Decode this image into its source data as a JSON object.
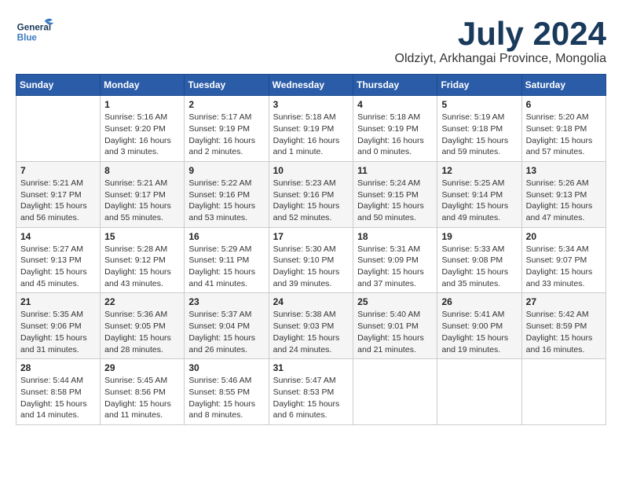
{
  "header": {
    "logo_general": "General",
    "logo_blue": "Blue",
    "month": "July 2024",
    "location": "Oldziyt, Arkhangai Province, Mongolia"
  },
  "weekdays": [
    "Sunday",
    "Monday",
    "Tuesday",
    "Wednesday",
    "Thursday",
    "Friday",
    "Saturday"
  ],
  "weeks": [
    [
      {
        "day": "",
        "info": ""
      },
      {
        "day": "1",
        "info": "Sunrise: 5:16 AM\nSunset: 9:20 PM\nDaylight: 16 hours\nand 3 minutes."
      },
      {
        "day": "2",
        "info": "Sunrise: 5:17 AM\nSunset: 9:19 PM\nDaylight: 16 hours\nand 2 minutes."
      },
      {
        "day": "3",
        "info": "Sunrise: 5:18 AM\nSunset: 9:19 PM\nDaylight: 16 hours\nand 1 minute."
      },
      {
        "day": "4",
        "info": "Sunrise: 5:18 AM\nSunset: 9:19 PM\nDaylight: 16 hours\nand 0 minutes."
      },
      {
        "day": "5",
        "info": "Sunrise: 5:19 AM\nSunset: 9:18 PM\nDaylight: 15 hours\nand 59 minutes."
      },
      {
        "day": "6",
        "info": "Sunrise: 5:20 AM\nSunset: 9:18 PM\nDaylight: 15 hours\nand 57 minutes."
      }
    ],
    [
      {
        "day": "7",
        "info": "Sunrise: 5:21 AM\nSunset: 9:17 PM\nDaylight: 15 hours\nand 56 minutes."
      },
      {
        "day": "8",
        "info": "Sunrise: 5:21 AM\nSunset: 9:17 PM\nDaylight: 15 hours\nand 55 minutes."
      },
      {
        "day": "9",
        "info": "Sunrise: 5:22 AM\nSunset: 9:16 PM\nDaylight: 15 hours\nand 53 minutes."
      },
      {
        "day": "10",
        "info": "Sunrise: 5:23 AM\nSunset: 9:16 PM\nDaylight: 15 hours\nand 52 minutes."
      },
      {
        "day": "11",
        "info": "Sunrise: 5:24 AM\nSunset: 9:15 PM\nDaylight: 15 hours\nand 50 minutes."
      },
      {
        "day": "12",
        "info": "Sunrise: 5:25 AM\nSunset: 9:14 PM\nDaylight: 15 hours\nand 49 minutes."
      },
      {
        "day": "13",
        "info": "Sunrise: 5:26 AM\nSunset: 9:13 PM\nDaylight: 15 hours\nand 47 minutes."
      }
    ],
    [
      {
        "day": "14",
        "info": "Sunrise: 5:27 AM\nSunset: 9:13 PM\nDaylight: 15 hours\nand 45 minutes."
      },
      {
        "day": "15",
        "info": "Sunrise: 5:28 AM\nSunset: 9:12 PM\nDaylight: 15 hours\nand 43 minutes."
      },
      {
        "day": "16",
        "info": "Sunrise: 5:29 AM\nSunset: 9:11 PM\nDaylight: 15 hours\nand 41 minutes."
      },
      {
        "day": "17",
        "info": "Sunrise: 5:30 AM\nSunset: 9:10 PM\nDaylight: 15 hours\nand 39 minutes."
      },
      {
        "day": "18",
        "info": "Sunrise: 5:31 AM\nSunset: 9:09 PM\nDaylight: 15 hours\nand 37 minutes."
      },
      {
        "day": "19",
        "info": "Sunrise: 5:33 AM\nSunset: 9:08 PM\nDaylight: 15 hours\nand 35 minutes."
      },
      {
        "day": "20",
        "info": "Sunrise: 5:34 AM\nSunset: 9:07 PM\nDaylight: 15 hours\nand 33 minutes."
      }
    ],
    [
      {
        "day": "21",
        "info": "Sunrise: 5:35 AM\nSunset: 9:06 PM\nDaylight: 15 hours\nand 31 minutes."
      },
      {
        "day": "22",
        "info": "Sunrise: 5:36 AM\nSunset: 9:05 PM\nDaylight: 15 hours\nand 28 minutes."
      },
      {
        "day": "23",
        "info": "Sunrise: 5:37 AM\nSunset: 9:04 PM\nDaylight: 15 hours\nand 26 minutes."
      },
      {
        "day": "24",
        "info": "Sunrise: 5:38 AM\nSunset: 9:03 PM\nDaylight: 15 hours\nand 24 minutes."
      },
      {
        "day": "25",
        "info": "Sunrise: 5:40 AM\nSunset: 9:01 PM\nDaylight: 15 hours\nand 21 minutes."
      },
      {
        "day": "26",
        "info": "Sunrise: 5:41 AM\nSunset: 9:00 PM\nDaylight: 15 hours\nand 19 minutes."
      },
      {
        "day": "27",
        "info": "Sunrise: 5:42 AM\nSunset: 8:59 PM\nDaylight: 15 hours\nand 16 minutes."
      }
    ],
    [
      {
        "day": "28",
        "info": "Sunrise: 5:44 AM\nSunset: 8:58 PM\nDaylight: 15 hours\nand 14 minutes."
      },
      {
        "day": "29",
        "info": "Sunrise: 5:45 AM\nSunset: 8:56 PM\nDaylight: 15 hours\nand 11 minutes."
      },
      {
        "day": "30",
        "info": "Sunrise: 5:46 AM\nSunset: 8:55 PM\nDaylight: 15 hours\nand 8 minutes."
      },
      {
        "day": "31",
        "info": "Sunrise: 5:47 AM\nSunset: 8:53 PM\nDaylight: 15 hours\nand 6 minutes."
      },
      {
        "day": "",
        "info": ""
      },
      {
        "day": "",
        "info": ""
      },
      {
        "day": "",
        "info": ""
      }
    ]
  ]
}
